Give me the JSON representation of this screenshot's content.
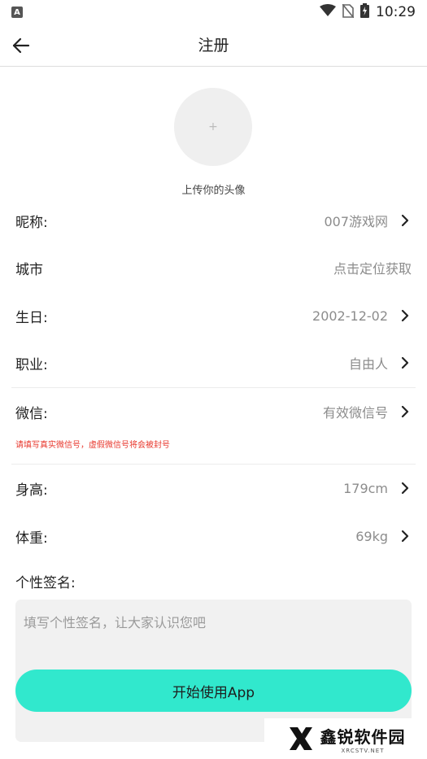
{
  "status_bar": {
    "app_icon_letter": "A",
    "time": "10:29"
  },
  "header": {
    "title": "注册"
  },
  "avatar": {
    "plus": "+",
    "caption": "上传你的头像"
  },
  "form": {
    "nickname": {
      "label": "昵称:",
      "value": "007游戏网"
    },
    "city": {
      "label": "城市",
      "value": "点击定位获取"
    },
    "birthday": {
      "label": "生日:",
      "value": "2002-12-02"
    },
    "occupation": {
      "label": "职业:",
      "value": "自由人"
    },
    "wechat": {
      "label": "微信:",
      "value": "有效微信号",
      "warning": "请填写真实微信号，虚假微信号将会被封号"
    },
    "height": {
      "label": "身高:",
      "value": "179cm"
    },
    "weight": {
      "label": "体重:",
      "value": "69kg"
    }
  },
  "signature": {
    "label": "个性签名:",
    "placeholder": "填写个性签名，让大家认识您吧"
  },
  "start_button": {
    "label": "开始使用App"
  },
  "watermark": {
    "main": "鑫锐软件园",
    "sub": "XRCSTV.NET"
  },
  "colors": {
    "accent": "#31e8cd",
    "warning": "#e8372c",
    "value_text": "#8c8c8c",
    "input_bg": "#f1f1f1"
  }
}
